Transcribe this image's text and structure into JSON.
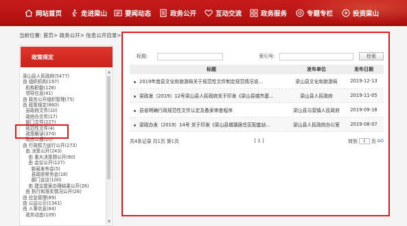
{
  "nav": {
    "items": [
      {
        "label": "网站首页",
        "icon": "home-icon"
      },
      {
        "label": "走进梁山",
        "icon": "walk-icon"
      },
      {
        "label": "要闻动态",
        "icon": "news-icon"
      },
      {
        "label": "政务公开",
        "icon": "document-icon"
      },
      {
        "label": "互动交流",
        "icon": "heart-icon"
      },
      {
        "label": "政务服务",
        "icon": "service-icon"
      },
      {
        "label": "专题专栏",
        "icon": "target-icon"
      },
      {
        "label": "投资梁山",
        "icon": "play-icon"
      }
    ],
    "colors": {
      "bar": "#c81c1c",
      "text": "#ffffff"
    }
  },
  "breadcrumb": "当前位置: 首页> 政务公开> 信息公开目录> 政策规定",
  "sidebar": {
    "title": "政策规定",
    "tree": [
      "梁山县人民政府(5477)",
      "由 组织机构(197)",
      "  机构职能(128)",
      "  领导信息(41)",
      "由 政务公开组织管理(75)",
      "由 政策规定(860)",
      "  县政府文件(10)",
      "  政府办文件(17)",
      "  部门文件(227)",
      "  规范性文件(4)",
      "  政策解读(374)",
      "  政府公报(20)",
      "由 行政权力运行公开(273)",
      "  由 决策公开(243)",
      "    由 重大决策预公开(90)",
      "    由 会议公开(127)",
      "      新闻发布会(5)",
      "      县政府常务会(18)",
      "      部门会议(100)",
      "    由 建议提案办理结果公开(26)",
      "  由 执行和落实情况公开(26)",
      "由 应急管理(89)",
      "由 公益公示(1341)",
      "由 人事信息(84)",
      "  政务动态(109)"
    ]
  },
  "search": {
    "title_label": "标题:",
    "index_label": "索引号:",
    "button": "检索"
  },
  "table": {
    "headers": {
      "title": "标题",
      "unit": "发布单位",
      "date": "发布日期"
    },
    "rows": [
      {
        "title": "2019年度县文化和旅游局关于规范性文件制定规范情况说...",
        "unit": "梁山县文化和旅游局",
        "date": "2019-12-13"
      },
      {
        "title": "梁政发（2019）12号梁山县人民政府关于印发《梁山县城市基...",
        "unit": "梁山县人民政府",
        "date": "2019-11-05"
      },
      {
        "title": "县省明确行政规范性文件认定及备案审查程序",
        "unit": "梁山县马营镇人民政府",
        "date": "2019-09-18"
      },
      {
        "title": "梁政办发（2019）14号 关于印发《梁山县城镇居住区配套幼...",
        "unit": "梁山县人民政府办公室",
        "date": "2019-08-07"
      }
    ]
  },
  "pager": {
    "summary": "共4条记录  共1页  第1页",
    "pages": "[ 1 ]",
    "goto_label": "转到",
    "goto_value": "1",
    "page_suffix": "页",
    "go_button": "GO"
  }
}
